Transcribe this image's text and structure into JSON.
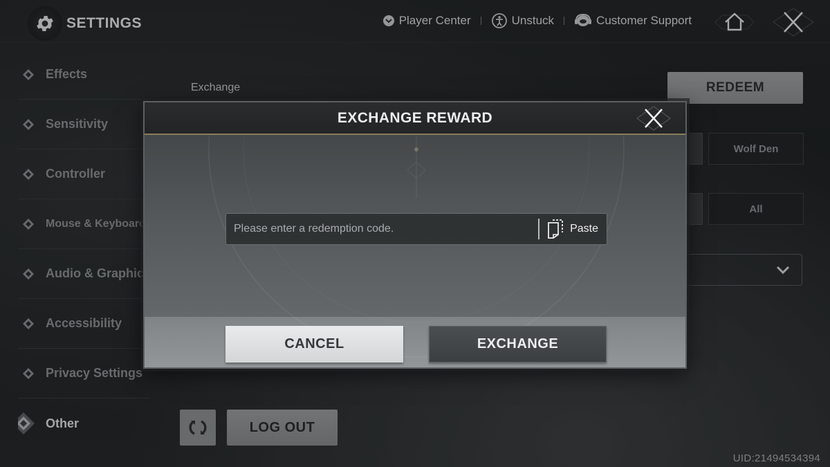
{
  "header": {
    "title": "SETTINGS",
    "links": [
      {
        "label": "Player Center",
        "icon": "player-center-icon"
      },
      {
        "label": "Unstuck",
        "icon": "unstuck-icon"
      },
      {
        "label": "Customer Support",
        "icon": "headset-icon"
      }
    ]
  },
  "sidebar": {
    "items": [
      {
        "label": "Effects",
        "active": false
      },
      {
        "label": "Sensitivity",
        "active": false
      },
      {
        "label": "Controller",
        "active": false
      },
      {
        "label": "Mouse & Keyboard",
        "active": false
      },
      {
        "label": "Audio & Graphics",
        "active": false
      },
      {
        "label": "Accessibility",
        "active": false
      },
      {
        "label": "Privacy Settings",
        "active": false
      },
      {
        "label": "Other",
        "active": true
      }
    ]
  },
  "main": {
    "exchange_label": "Exchange",
    "redeem_label": "REDEEM",
    "server_option": "Wolf Den",
    "scope_option": "All",
    "logout_label": "LOG OUT",
    "uid": "UID:21494534394"
  },
  "modal": {
    "title": "EXCHANGE REWARD",
    "code_placeholder": "Please enter a redemption code.",
    "code_value": "",
    "paste_label": "Paste",
    "cancel_label": "CANCEL",
    "exchange_label": "EXCHANGE"
  },
  "colors": {
    "accent_gold": "#8b7d5c",
    "background": "#1e2122",
    "primary_button": "#e1e3e4",
    "dark_button": "#43474a"
  }
}
